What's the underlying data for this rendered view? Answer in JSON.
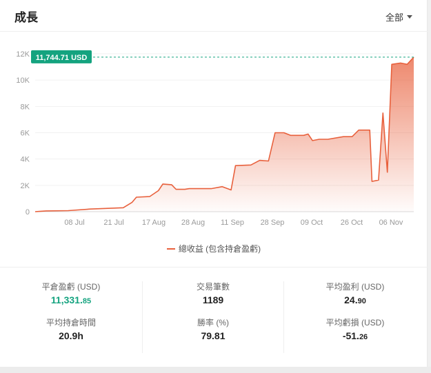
{
  "header": {
    "title": "成長",
    "filter_label": "全部"
  },
  "chart_data": {
    "type": "area",
    "title": "",
    "legend": [
      "總收益 (包含持倉盈虧)"
    ],
    "xlabel": "",
    "ylabel": "",
    "ylim": [
      0,
      12000
    ],
    "y_ticks": [
      0,
      2000,
      4000,
      6000,
      8000,
      10000,
      12000
    ],
    "y_tick_labels": [
      "0",
      "2K",
      "4K",
      "6K",
      "8K",
      "10K",
      "12K"
    ],
    "x_ticks": [
      "08 Jul",
      "21 Jul",
      "17 Aug",
      "28 Aug",
      "11 Sep",
      "28 Sep",
      "09 Oct",
      "26 Oct",
      "06 Nov"
    ],
    "current_value_label": "11,744.71 USD",
    "current_value": 11744.71,
    "series": [
      {
        "name": "總收益 (包含持倉盈虧)",
        "color": "#e8603c",
        "points": [
          [
            0,
            0
          ],
          [
            0.2,
            20
          ],
          [
            0.5,
            60
          ],
          [
            1.5,
            80
          ],
          [
            2.5,
            200
          ],
          [
            3.3,
            250
          ],
          [
            4,
            300
          ],
          [
            4.4,
            700
          ],
          [
            4.6,
            1100
          ],
          [
            5.2,
            1150
          ],
          [
            5.6,
            1600
          ],
          [
            5.8,
            2100
          ],
          [
            6.2,
            2050
          ],
          [
            6.4,
            1700
          ],
          [
            6.8,
            1700
          ],
          [
            7.0,
            1750
          ],
          [
            8.0,
            1750
          ],
          [
            8.5,
            1900
          ],
          [
            8.9,
            1650
          ],
          [
            9.1,
            3500
          ],
          [
            9.8,
            3550
          ],
          [
            10.2,
            3900
          ],
          [
            10.6,
            3850
          ],
          [
            10.9,
            6000
          ],
          [
            11.3,
            6000
          ],
          [
            11.6,
            5800
          ],
          [
            12.2,
            5800
          ],
          [
            12.4,
            5900
          ],
          [
            12.6,
            5400
          ],
          [
            12.9,
            5500
          ],
          [
            13.3,
            5500
          ],
          [
            14.0,
            5700
          ],
          [
            14.4,
            5700
          ],
          [
            14.7,
            6200
          ],
          [
            15.2,
            6200
          ],
          [
            15.3,
            2300
          ],
          [
            15.6,
            2400
          ],
          [
            15.8,
            7500
          ],
          [
            16.0,
            3000
          ],
          [
            16.2,
            11200
          ],
          [
            16.6,
            11300
          ],
          [
            16.9,
            11200
          ],
          [
            17.2,
            11744.71
          ]
        ]
      }
    ]
  },
  "stats": {
    "open_pnl": {
      "label": "平倉盈虧 (USD)",
      "int": "11,331.",
      "dec": "85"
    },
    "avg_hold": {
      "label": "平均持倉時間",
      "value": "20.9h"
    },
    "trades": {
      "label": "交易筆數",
      "value": "1189"
    },
    "win_rate": {
      "label": "勝率 (%)",
      "value": "79.81"
    },
    "avg_profit": {
      "label": "平均盈利 (USD)",
      "int": "24.",
      "dec": "90"
    },
    "avg_loss": {
      "label": "平均虧損 (USD)",
      "int": "-51.",
      "dec": "26"
    }
  },
  "colors": {
    "accent": "#e8603c",
    "positive": "#14a37f",
    "marker": "#14a37f"
  }
}
